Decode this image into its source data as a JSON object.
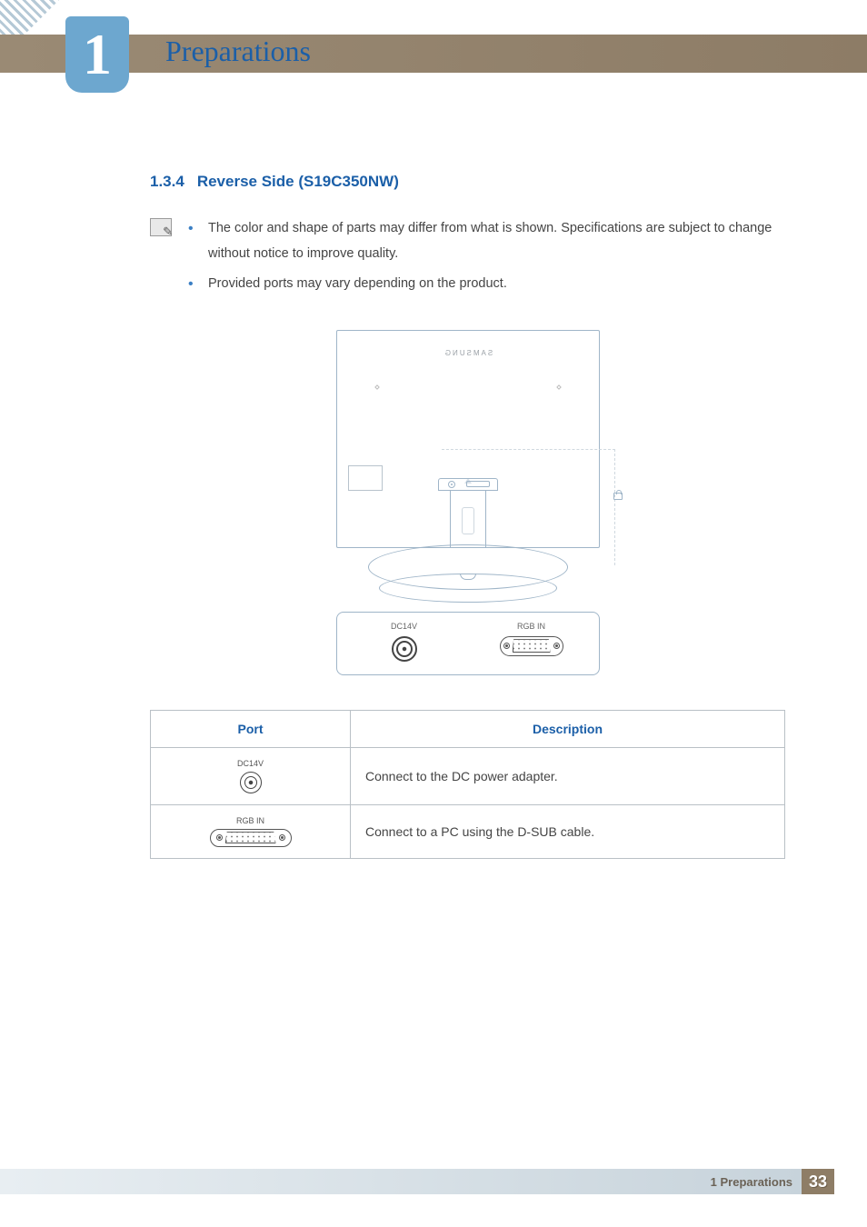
{
  "chapter": {
    "number": "1",
    "title": "Preparations"
  },
  "section": {
    "number": "1.3.4",
    "title": "Reverse Side (S19C350NW)"
  },
  "notes": [
    "The color and shape of parts may differ from what is shown. Specifications are subject to change without notice to improve quality.",
    "Provided ports may vary depending on the product."
  ],
  "diagram": {
    "brand": "SAMSUNG",
    "callouts": {
      "dc": "DC14V",
      "rgb": "RGB IN"
    }
  },
  "table": {
    "headers": {
      "port": "Port",
      "desc": "Description"
    },
    "rows": [
      {
        "port_label": "DC14V",
        "port_type": "dc",
        "desc": "Connect to the DC power adapter."
      },
      {
        "port_label": "RGB IN",
        "port_type": "vga",
        "desc": "Connect to a PC using the D-SUB cable."
      }
    ]
  },
  "footer": {
    "text": "1 Preparations",
    "page": "33"
  }
}
